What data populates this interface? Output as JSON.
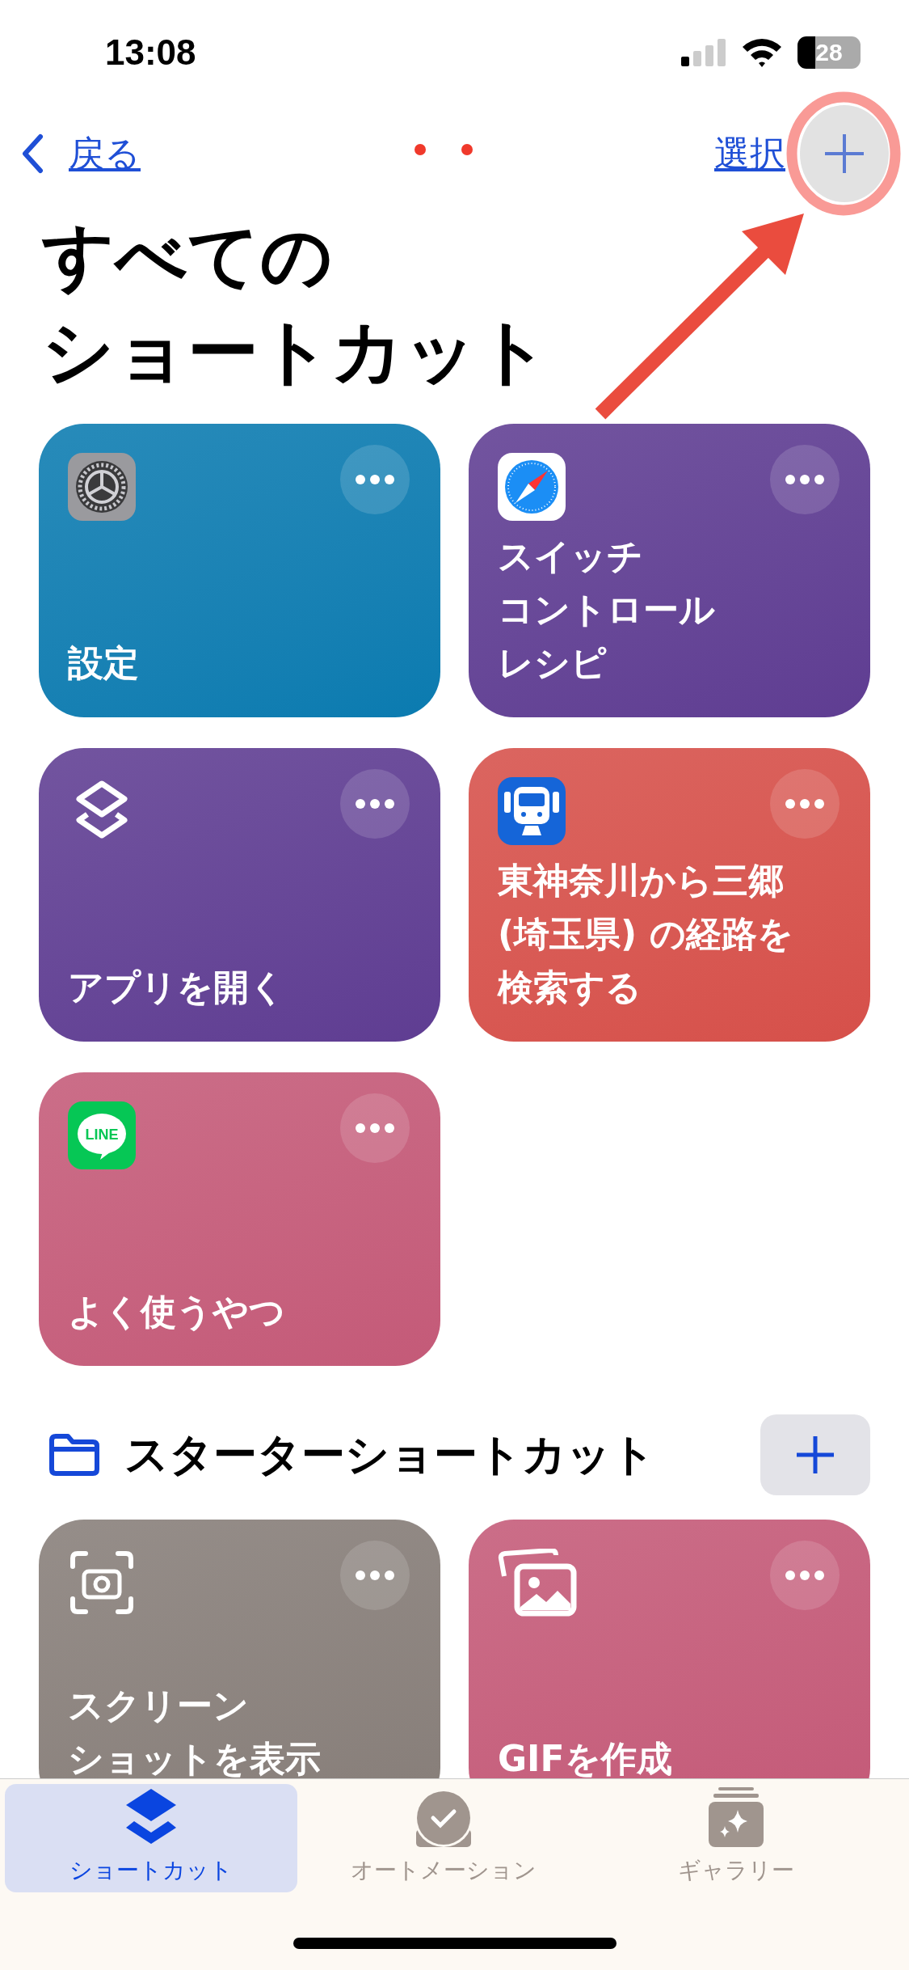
{
  "status_bar": {
    "time": "13:08",
    "battery": "28"
  },
  "nav": {
    "back": "戻る",
    "select": "選択"
  },
  "title_lines": [
    "すべての",
    "ショートカット"
  ],
  "shortcuts": [
    {
      "kind": "settings",
      "color": "#0a7bb0",
      "lines": [
        "設定"
      ]
    },
    {
      "kind": "safari",
      "color": "#5f3d92",
      "lines": [
        "スイッチ",
        "コントロール",
        "レシピ"
      ]
    },
    {
      "kind": "layers",
      "color": "#5f3d92",
      "lines": [
        "アプリを開く"
      ]
    },
    {
      "kind": "train",
      "color": "#d6504a",
      "lines": [
        "東神奈川から三郷",
        "(埼玉県) の経路を",
        "検索する"
      ]
    },
    {
      "kind": "line",
      "color": "#c45a78",
      "app_label": "LINE",
      "lines": [
        "よく使うやつ"
      ]
    }
  ],
  "starter_section": {
    "title": "スターターショートカット"
  },
  "starter_shortcuts": [
    {
      "kind": "screenshot",
      "color": "#877e79",
      "lines": [
        "スクリーン",
        "ショットを表示"
      ]
    },
    {
      "kind": "photos",
      "color": "#c45a78",
      "lines": [
        "GIFを作成"
      ]
    }
  ],
  "tabs": [
    {
      "kind": "layers",
      "label": "ショートカット",
      "selected": true
    },
    {
      "kind": "automation",
      "label": "オートメーション",
      "selected": false
    },
    {
      "kind": "gallery",
      "label": "ギャラリー",
      "selected": false
    }
  ]
}
